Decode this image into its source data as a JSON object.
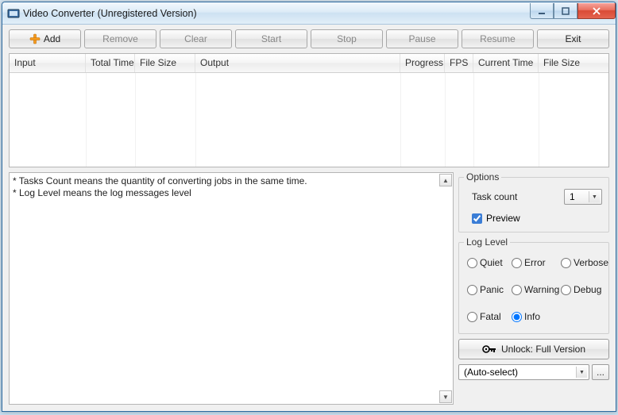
{
  "window": {
    "title": "Video Converter  (Unregistered Version)"
  },
  "toolbar": {
    "add": "Add",
    "remove": "Remove",
    "clear": "Clear",
    "start": "Start",
    "stop": "Stop",
    "pause": "Pause",
    "resume": "Resume",
    "exit": "Exit"
  },
  "columns": {
    "input": "Input",
    "totaltime": "Total Time",
    "filesize": "File Size",
    "output": "Output",
    "progress": "Progress",
    "fps": "FPS",
    "currenttime": "Current Time",
    "filesize2": "File Size"
  },
  "log": {
    "line1": "* Tasks Count means the quantity of converting jobs in the same time.",
    "line2": "* Log Level means the log messages level"
  },
  "options": {
    "legend": "Options",
    "task_count_label": "Task count",
    "task_count_value": "1",
    "preview_label": "Preview"
  },
  "loglevel": {
    "legend": "Log Level",
    "quiet": "Quiet",
    "error": "Error",
    "verbose": "Verbose",
    "panic": "Panic",
    "warning": "Warning",
    "debug": "Debug",
    "fatal": "Fatal",
    "info": "Info"
  },
  "unlock": {
    "label": "Unlock: Full Version"
  },
  "autoselect": {
    "value": "(Auto-select)",
    "dots": "..."
  }
}
